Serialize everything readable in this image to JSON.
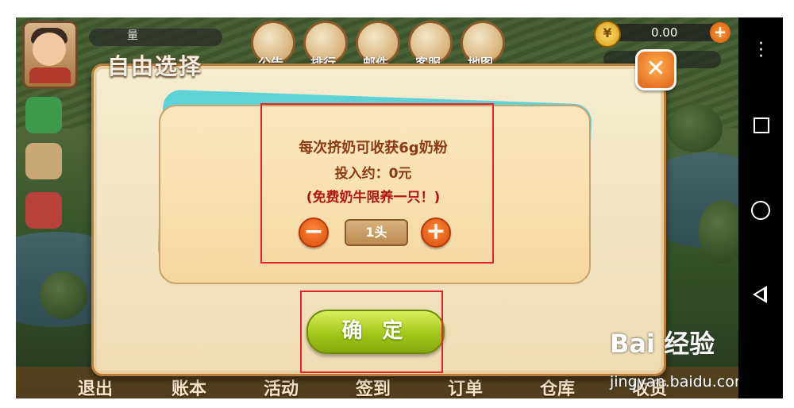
{
  "hud": {
    "player_name": "量",
    "menu": [
      "公告",
      "排行",
      "邮件",
      "客服",
      "地图"
    ],
    "coins": "0.00",
    "coin_symbol": "¥",
    "coin_plus": "+"
  },
  "dialog": {
    "title": "自由选择",
    "close": "✕",
    "info_line1": "每次挤奶可收获6g奶粉",
    "info_line2": "投入约：0元",
    "info_line3": "(免费奶牛限养一只！)",
    "minus": "−",
    "quantity": "1头",
    "plus": "+",
    "confirm": "确 定"
  },
  "bottom_nav": [
    "退出",
    "账本",
    "活动",
    "签到",
    "订单",
    "仓库",
    "收货"
  ],
  "watermark": {
    "brand": "Bai 经验",
    "url": "jingyan.baidu.com"
  }
}
